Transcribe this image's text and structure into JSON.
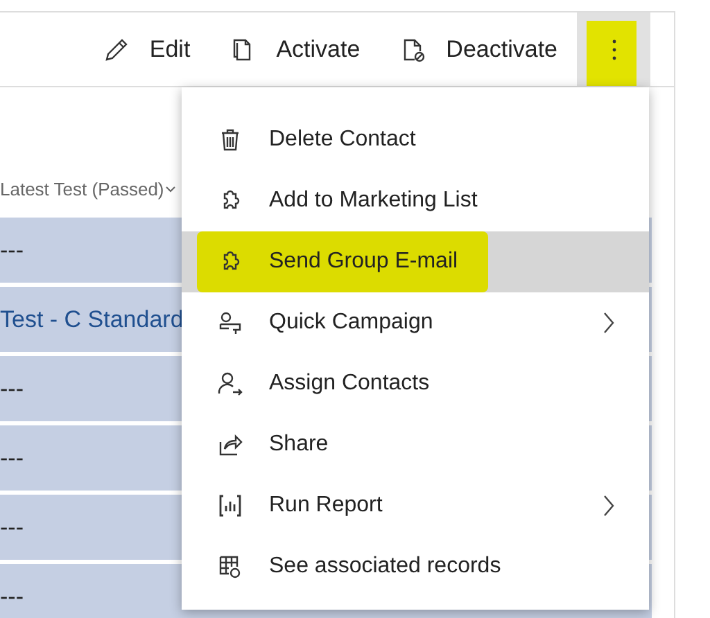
{
  "toolbar": {
    "buttons": [
      {
        "label": "Edit"
      },
      {
        "label": "Activate"
      },
      {
        "label": "Deactivate"
      }
    ],
    "more": {
      "expanded": true,
      "highlighted": true
    }
  },
  "grid": {
    "column_header": "Latest Test (Passed)",
    "rows": [
      {
        "kind": "text",
        "value": "---"
      },
      {
        "kind": "link",
        "value": "Test - C Standard"
      },
      {
        "kind": "text",
        "value": "---"
      },
      {
        "kind": "text",
        "value": "---"
      },
      {
        "kind": "text",
        "value": "---"
      },
      {
        "kind": "text",
        "value": "---"
      }
    ]
  },
  "menu": {
    "items": [
      {
        "label": "Delete Contact",
        "submenu": false,
        "selected": false,
        "highlighted": false
      },
      {
        "label": "Add to Marketing List",
        "submenu": false,
        "selected": false,
        "highlighted": false
      },
      {
        "label": "Send Group E-mail",
        "submenu": false,
        "selected": true,
        "highlighted": true
      },
      {
        "label": "Quick Campaign",
        "submenu": true,
        "selected": false,
        "highlighted": false
      },
      {
        "label": "Assign Contacts",
        "submenu": false,
        "selected": false,
        "highlighted": false
      },
      {
        "label": "Share",
        "submenu": false,
        "selected": false,
        "highlighted": false
      },
      {
        "label": "Run Report",
        "submenu": true,
        "selected": false,
        "highlighted": false
      },
      {
        "label": "See associated records",
        "submenu": false,
        "selected": false,
        "highlighted": false
      }
    ]
  }
}
